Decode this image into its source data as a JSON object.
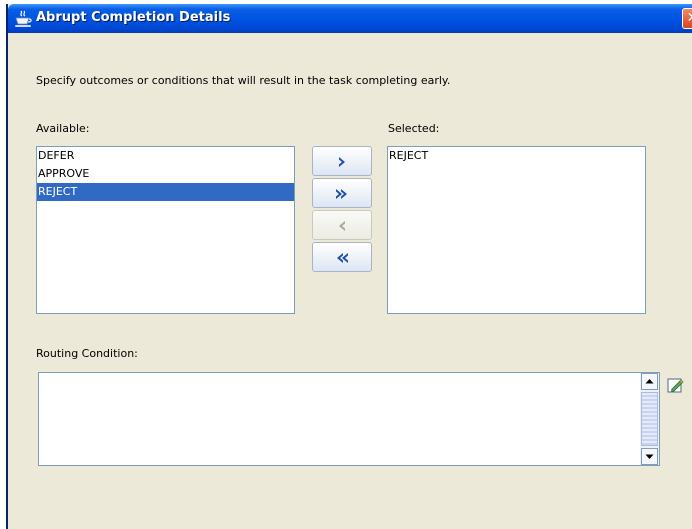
{
  "window": {
    "title": "Abrupt Completion Details"
  },
  "instructions": "Specify outcomes or conditions that will result in the task completing early.",
  "available": {
    "label": "Available:",
    "items": [
      "DEFER",
      "APPROVE",
      "REJECT"
    ],
    "selected_item": "REJECT"
  },
  "selected": {
    "label": "Selected:",
    "items": [
      "REJECT"
    ]
  },
  "routing": {
    "label": "Routing Condition:",
    "value": ""
  },
  "icons": {
    "window": "coffee-cup-icon",
    "move_one_right": "chevron-right-icon",
    "move_all_right": "double-chevron-right-icon",
    "move_one_left": "chevron-left-icon",
    "move_all_left": "double-chevron-left-icon",
    "edit_expression": "edit-pencil-icon",
    "close": "close-icon"
  },
  "colors": {
    "titlebar": "#0054e3",
    "selection": "#316ac5",
    "dialog_bg": "#ece9d8",
    "arrow": "#1e4fa8"
  }
}
